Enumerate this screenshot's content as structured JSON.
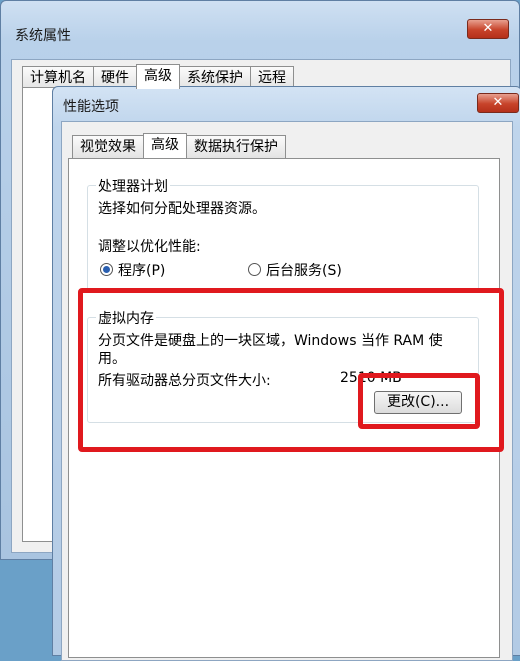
{
  "outer_window": {
    "title": "系统属性",
    "close_label": "✕",
    "tabs": [
      {
        "label": "计算机名"
      },
      {
        "label": "硬件"
      },
      {
        "label": "高级"
      },
      {
        "label": "系统保护"
      },
      {
        "label": "远程"
      }
    ]
  },
  "inner_window": {
    "title": "性能选项",
    "close_label": "✕",
    "tabs": [
      {
        "label": "视觉效果"
      },
      {
        "label": "高级"
      },
      {
        "label": "数据执行保护"
      }
    ],
    "processor": {
      "group_title": "处理器计划",
      "description": "选择如何分配处理器资源。",
      "adjust_label": "调整以优化性能:",
      "option_programs": "程序(P)",
      "option_services": "后台服务(S)"
    },
    "virtual_memory": {
      "group_title": "虚拟内存",
      "description_line1": "分页文件是硬盘上的一块区域，Windows 当作 RAM 使",
      "description_line2": "用。",
      "total_label": "所有驱动器总分页文件大小:",
      "total_value": "2510 MB",
      "change_button": "更改(C)..."
    }
  },
  "colors": {
    "highlight": "#e0191e",
    "radio_selected": "#2a5fb0"
  }
}
